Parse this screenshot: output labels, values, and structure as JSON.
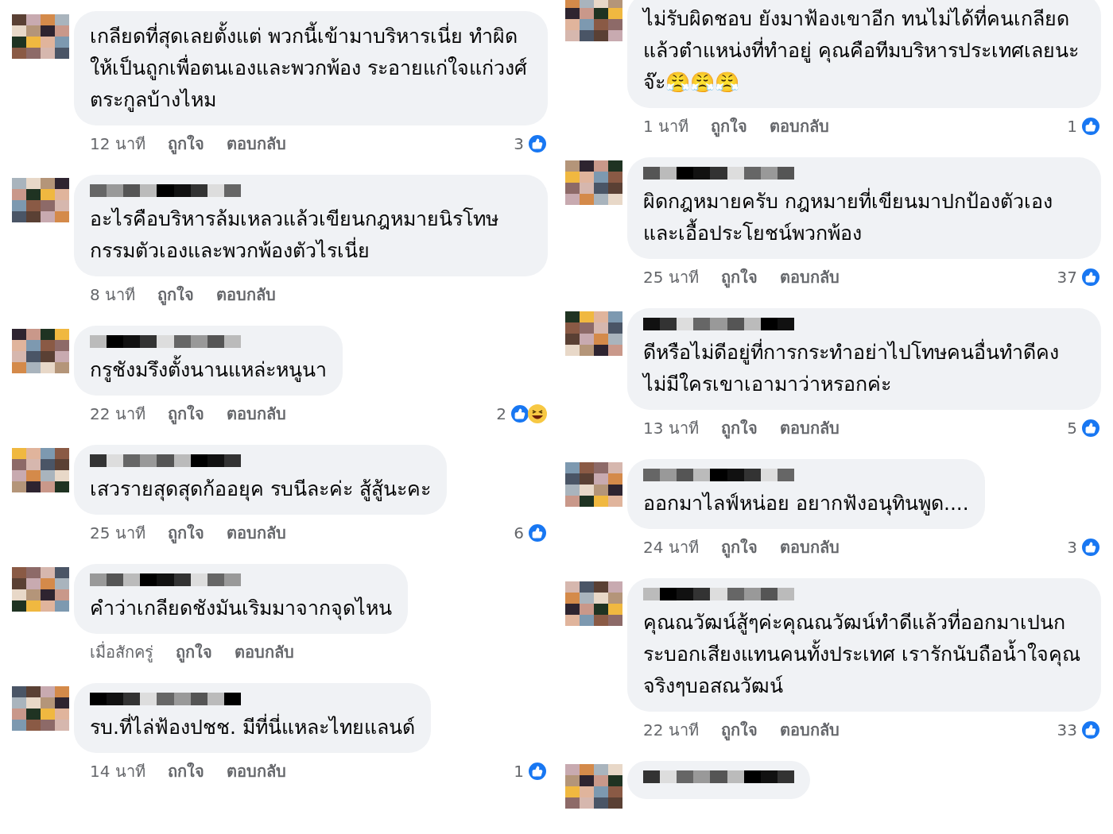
{
  "columns": [
    {
      "comments": [
        {
          "name_shown": false,
          "text": "เกลียดที่สุดเลยตั้งแต่ พวกนี้เข้ามาบริหารเนี่ย ทำผิดให้เป็นถูกเพื่อตนเองและพวกพ้อง ระอายแก่ใจแก่วงศ์ตระกูลบ้างไหม",
          "time": "12 นาที",
          "like": "ถูกใจ",
          "reply": "ตอบกลับ",
          "count": "3",
          "reactions": [
            {
              "kind": "like"
            }
          ]
        },
        {
          "name_shown": true,
          "text": "อะไรคือบริหารล้มเหลวแล้วเขียนกฎหมายนิรโทษกรรมตัวเองและพวกพ้องตัวไรเนี่ย",
          "time": "8 นาที",
          "like": "ถูกใจ",
          "reply": "ตอบกลับ"
        },
        {
          "name_shown": true,
          "text": "กรูชังมรึงตั้งนานแหล่ะหนูนา",
          "time": "22 นาที",
          "like": "ถูกใจ",
          "reply": "ตอบกลับ",
          "count": "2",
          "reactions": [
            {
              "kind": "like"
            },
            {
              "kind": "haha"
            }
          ]
        },
        {
          "name_shown": true,
          "text": "เสวรายสุดสุดก้ออยุค รบนีละค่ะ สู้สู้นะคะ",
          "time": "25 นาที",
          "like": "ถูกใจ",
          "reply": "ตอบกลับ",
          "count": "6",
          "reactions": [
            {
              "kind": "like"
            }
          ]
        },
        {
          "name_shown": true,
          "text": "คำว่าเกลียดชังมันเริมมาจากจุดไหน",
          "time": "เมื่อสักครู่",
          "like": "ถูกใจ",
          "reply": "ตอบกลับ"
        },
        {
          "name_shown": true,
          "text": "รบ.ที่ไล่ฟ้องปชช. มีที่นี่แหละไทยแลนด์",
          "time": "14 นาที",
          "like": "ถกใจ",
          "reply": "ตอบกลับ",
          "count": "1",
          "reactions": [
            {
              "kind": "like"
            }
          ]
        }
      ]
    },
    {
      "comments": [
        {
          "name_shown": false,
          "text": "ไม่รับผิดชอบ ยังมาฟ้องเขาอีก ทนไม่ได้ที่คนเกลียด แล้วตำแหน่งที่ทำอยู่ คุณคือทีมบริหารประเทศเลยนะจ๊ะ😤😤😤",
          "time": "1 นาที",
          "like": "ถูกใจ",
          "reply": "ตอบกลับ",
          "count": "1",
          "reactions": [
            {
              "kind": "like"
            }
          ]
        },
        {
          "name_shown": true,
          "text": "ผิดกฎหมายครับ  กฎหมายที่เขียนมาปกป้องตัวเองและเอื้อประโยชน์พวกพ้อง",
          "time": "25 นาที",
          "like": "ถูกใจ",
          "reply": "ตอบกลับ",
          "count": "37",
          "reactions": [
            {
              "kind": "like"
            }
          ]
        },
        {
          "name_shown": true,
          "text": "ดีหรือไม่ดีอยู่ที่การกระทำอย่าไปโทษคนอื่นทำดีคงไม่มีใครเขาเอามาว่าหรอกค่ะ",
          "time": "13 นาที",
          "like": "ถูกใจ",
          "reply": "ตอบกลับ",
          "count": "5",
          "reactions": [
            {
              "kind": "like"
            }
          ]
        },
        {
          "name_shown": true,
          "text": "ออกมาไลฟ์หน่อย อยากฟังอนุทินพูด....",
          "time": "24 นาที",
          "like": "ถูกใจ",
          "reply": "ตอบกลับ",
          "count": "3",
          "reactions": [
            {
              "kind": "like"
            }
          ]
        },
        {
          "name_shown": true,
          "text": "คุณณวัฒน์สู้ๆค่ะคุณณวัฒน์ทำดีแล้วที่ออกมาเปนกระบอกเสียงแทนคนทั้งประเทศ เรารักนับถือน้ำใจคุณจริงๆบอสณวัฒน์",
          "time": "22 นาที",
          "like": "ถูกใจ",
          "reply": "ตอบกลับ",
          "count": "33",
          "reactions": [
            {
              "kind": "like"
            }
          ]
        },
        {
          "name_shown": true
        }
      ]
    }
  ]
}
